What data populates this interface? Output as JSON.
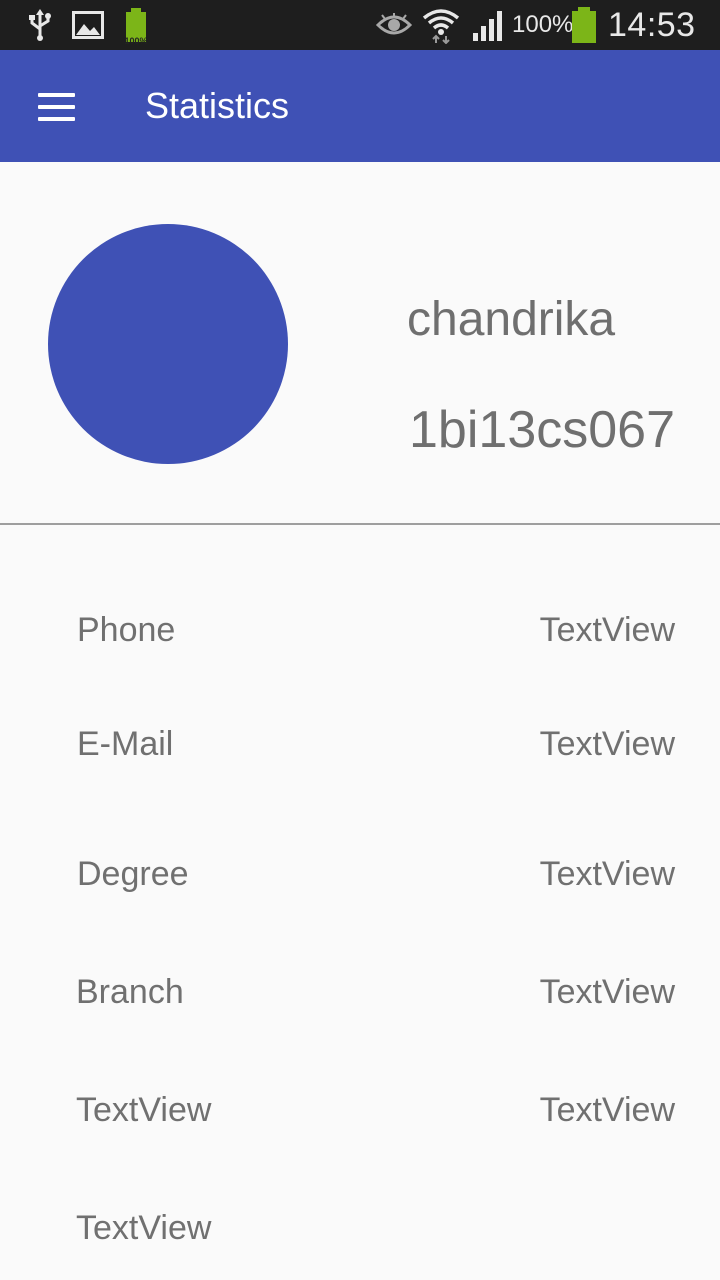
{
  "status_bar": {
    "battery_small_label": "100%",
    "battery_percent": "100%",
    "time": "14:53",
    "icons": [
      "usb-icon",
      "image-icon",
      "battery-small-icon",
      "eye-icon",
      "wifi-icon",
      "signal-icon",
      "battery-icon"
    ]
  },
  "app_bar": {
    "title": "Statistics",
    "menu_icon": "hamburger-menu-icon",
    "color": "#3f51b5"
  },
  "profile": {
    "name": "chandrika",
    "id": "1bi13cs067",
    "avatar_color": "#3f51b5"
  },
  "info_rows": [
    {
      "label": "Phone",
      "value": "TextView"
    },
    {
      "label": "E-Mail",
      "value": "TextView"
    },
    {
      "label": "Degree",
      "value": "TextView"
    },
    {
      "label": "Branch",
      "value": "TextView"
    },
    {
      "label": "TextView",
      "value": "TextView"
    },
    {
      "label": "TextView",
      "value": ""
    }
  ]
}
